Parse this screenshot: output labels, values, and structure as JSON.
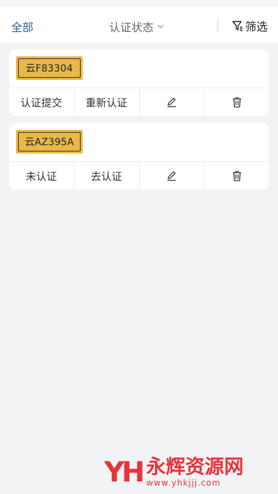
{
  "filter_bar": {
    "all_label": "全部",
    "status_label": "认证状态",
    "filter_label": "筛选"
  },
  "vehicles": [
    {
      "plate": "云F83304",
      "status_text": "认证提交",
      "action_text": "重新认证"
    },
    {
      "plate": "云AZ395A",
      "status_text": "未认证",
      "action_text": "去认证"
    }
  ],
  "icons": {
    "chevron": "chevron-down-icon",
    "filter": "filter-icon",
    "edit": "edit-pencil-icon",
    "delete": "trash-icon"
  },
  "watermark": {
    "logo": "YH",
    "name": "永辉资源网",
    "url": "www.yhkjjj.com"
  },
  "colors": {
    "accent": "#2f5ea3",
    "plate_yellow": "#e8b94a",
    "background": "#f2f3f5",
    "watermark_red": "#e8343a"
  }
}
